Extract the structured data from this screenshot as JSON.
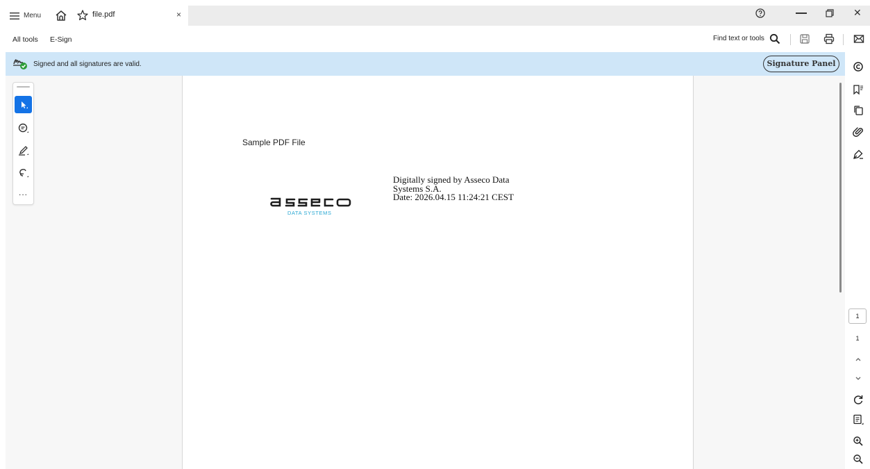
{
  "titlebar": {
    "menu_label": "Menu",
    "tab_title": "file.pdf",
    "tab_close": "×",
    "window_close": "✕"
  },
  "toolbar": {
    "all_tools": "All tools",
    "esign": "E-Sign",
    "find_label": "Find text or tools"
  },
  "signature_bar": {
    "status_text": "Signed and all signatures are valid.",
    "panel_button": "Signature Panel",
    "status_color": "#cfe6f8"
  },
  "left_tools": {
    "more": "..."
  },
  "document": {
    "heading": "Sample PDF File",
    "logo_sub": "DATA SYSTEMS",
    "signature_lines": [
      "Digitally signed by Asseco Data",
      "Systems S.A.",
      "Date: 2026.04.15 11:24:21 CEST"
    ]
  },
  "rail": {
    "current_page": "1",
    "total_pages": "1"
  },
  "colors": {
    "accent": "#1473e6",
    "logo_sub": "#2aa8d3"
  }
}
